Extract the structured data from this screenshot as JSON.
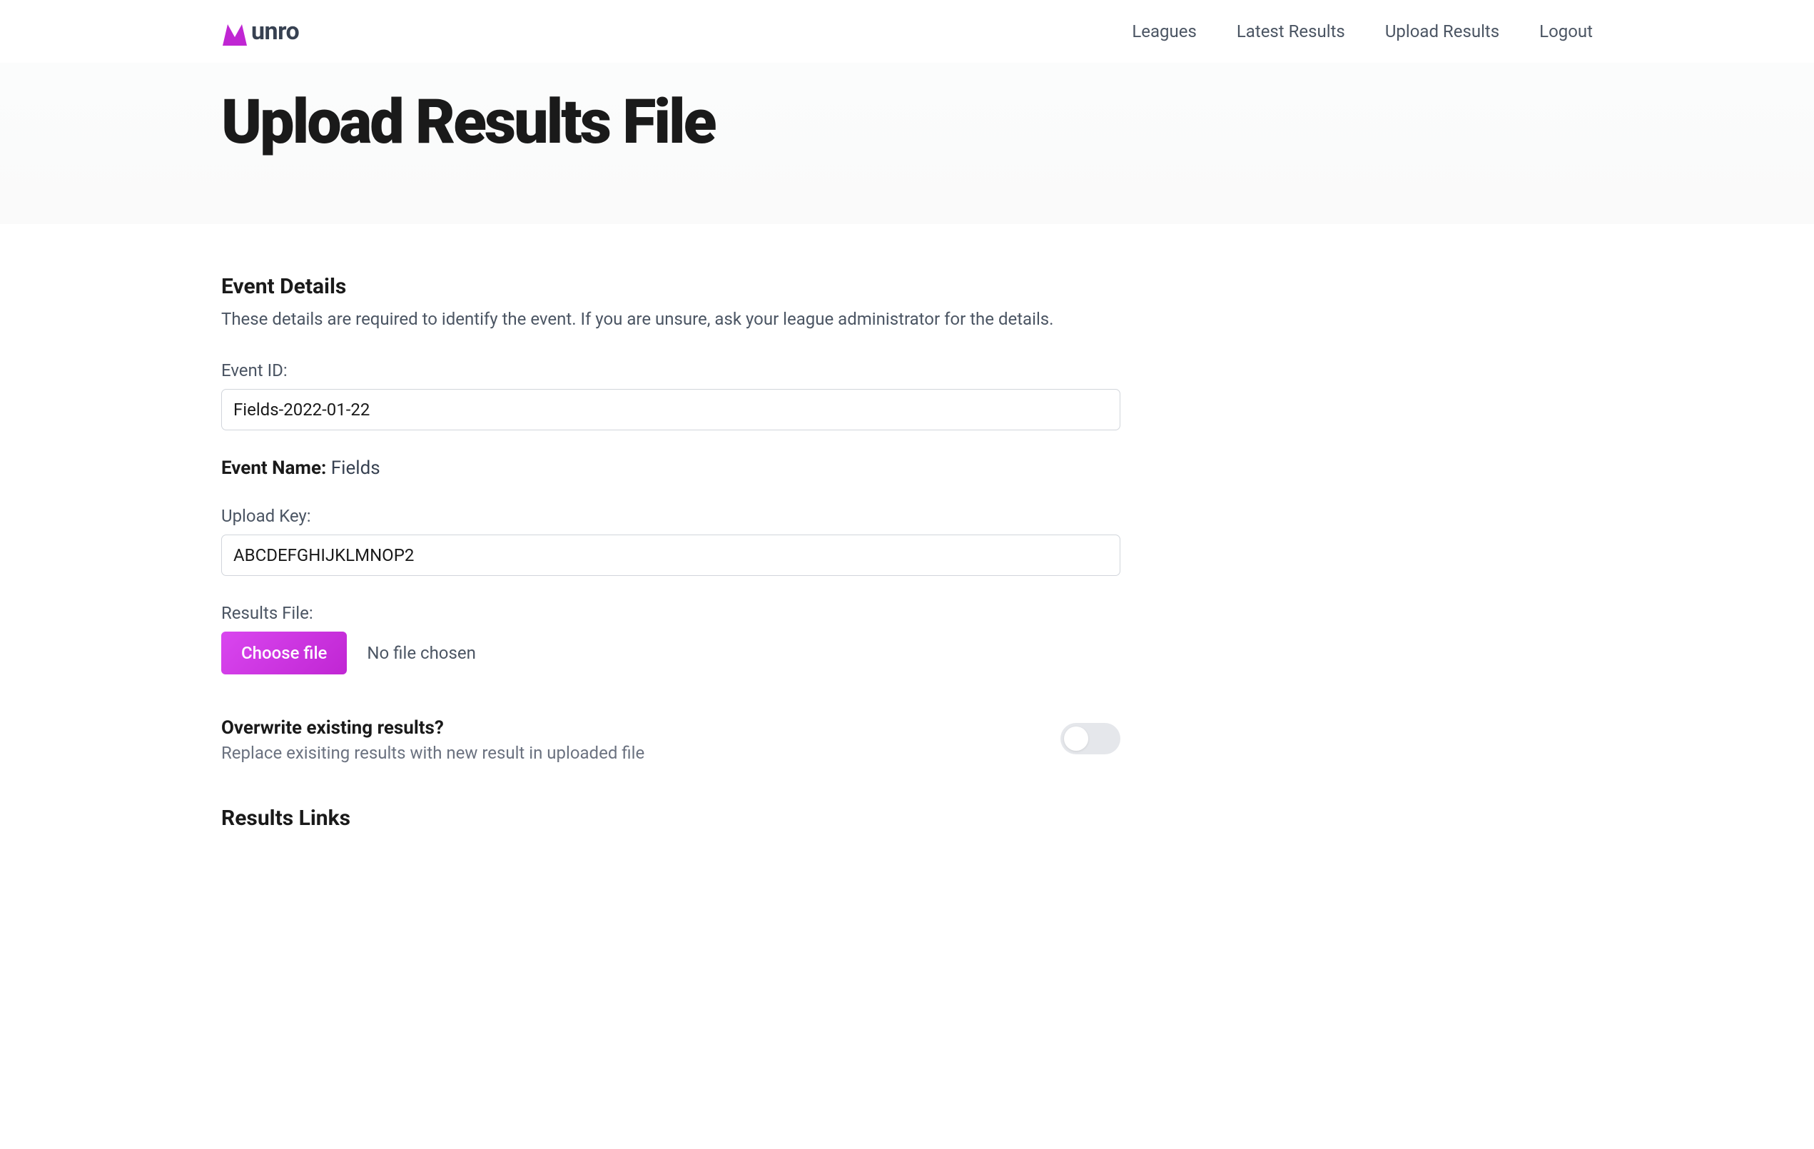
{
  "brand": {
    "name": "unro",
    "color": "#c026d3"
  },
  "nav": {
    "leagues": "Leagues",
    "latest_results": "Latest Results",
    "upload_results": "Upload Results",
    "logout": "Logout"
  },
  "page": {
    "title": "Upload Results File"
  },
  "event_details": {
    "title": "Event Details",
    "description": "These details are required to identify the event. If you are unsure, ask your league administrator for the details.",
    "event_id_label": "Event ID:",
    "event_id_value": "Fields-2022-01-22",
    "event_name_label": "Event Name:",
    "event_name_value": "Fields",
    "upload_key_label": "Upload Key:",
    "upload_key_value": "ABCDEFGHIJKLMNOP2",
    "results_file_label": "Results File:",
    "choose_file_button": "Choose file",
    "file_status": "No file chosen"
  },
  "overwrite": {
    "title": "Overwrite existing results?",
    "description": "Replace exisiting results with new result in uploaded file",
    "enabled": false
  },
  "results_links": {
    "title": "Results Links"
  }
}
